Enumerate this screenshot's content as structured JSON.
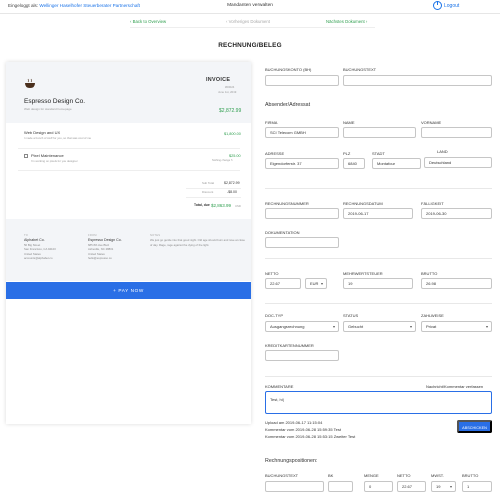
{
  "header": {
    "logged_in_prefix": "Eingeloggt als:",
    "organization": "Wellinger Haselhofer Steuerberater Partnerschaft",
    "title": "Mandanten verwalten",
    "logout": "Logout"
  },
  "nav": {
    "back": "‹ Back to Overview",
    "previous": "‹ Vorheriges Dokument",
    "next": "Nächstes Dokument ›"
  },
  "page_title": "RECHNUNG/BELEG",
  "invoice": {
    "word": "INVOICE",
    "meta1": "#00024",
    "meta2": "June 1st, 2019",
    "company": "Espresso Design Co.",
    "tagline": "Web design for standard homepage",
    "total": "$2,872.99",
    "items": [
      {
        "title": "Web Design and UX",
        "desc": "I made a bunch of stuff for you, so that was cool of me",
        "price": "$1,800.00"
      },
      {
        "title": "Pixel Maintenance",
        "desc": "I'm working on pixels for you designer",
        "price": "$25.00",
        "note": "Nothing change ↻"
      }
    ],
    "summary": [
      {
        "label": "Sub Total",
        "value": "$2,872.99"
      },
      {
        "label": "Discount",
        "value": "-$8.00"
      },
      {
        "label": "Total, due",
        "value": "$2,863.99",
        "currency": "USD"
      }
    ],
    "footer": {
      "to": {
        "head": "TO",
        "name": "Alphabet Co.",
        "lines": [
          "50 Big Street",
          "San Francisco, CA 94103",
          "United States",
          "accounts@alphabet.co"
        ]
      },
      "from": {
        "head": "FROM",
        "name": "Espresso Design Co.",
        "lines": [
          "685 8th Ave Blvd",
          "Asheville, NC 28801",
          "United States",
          "hello@espresso.co"
        ]
      },
      "notes": {
        "head": "NOTES",
        "text": "We just go gentle into that good night. Old age should burn and rave at close of day. Rage, rage against the dying of the light."
      }
    },
    "pay_button": "+ PAY NOW"
  },
  "form": {
    "buchungskonto_label": "BUCHUNGSKONTO (BH)",
    "buchungstext_label": "BUCHUNGSTEXT",
    "absender_head": "Absender/Adressat",
    "firma_label": "FIRMA",
    "firma_value": "SCI Telecom GMBH",
    "name_label": "NAME",
    "vorname_label": "VORNAME",
    "adresse_label": "ADRESSE",
    "adresse_value": "Eigendorferstr. 37",
    "plz_label": "PLZ",
    "plz_value": "6840",
    "stadt_label": "STADT",
    "stadt_value": "Montafour",
    "land_label": "LAND",
    "land_value": "Deutschland",
    "rechnungsnummer_label": "RECHNUNGSNUMMER",
    "rechnungsdatum_label": "RECHNUNGSDATUM",
    "rechnungsdatum_value": "2019-06-17",
    "faelligkeit_label": "FÄLLIGKEIT",
    "faelligkeit_value": "2019-06-30",
    "dokumentation_label": "DOKUMENTATION",
    "netto_label": "NETTO",
    "netto_value": "22.67",
    "currency_value": "EUR",
    "mwst_label": "MEHRWERTSTEUER",
    "mwst_value": "19",
    "brutto_label": "BRUTTO",
    "brutto_value": "26.98",
    "doctyp_label": "DOC-TYP",
    "doctyp_value": "Ausgangsrechnung",
    "status_label": "STATUS",
    "status_value": "Gebucht",
    "zahlweise_label": "ZAHLWEISE",
    "zahlweise_value": "Privat",
    "kreditkarte_label": "KREDITKARTENNUMMER",
    "kommentare_label": "KOMMENTARE",
    "kommentar_link": "Nachricht/Kommentar verfassen",
    "kommentar_value": "Test, hi|",
    "absenden": "ABSCHICKEN",
    "log": [
      "Upload am 2019-06-17 11:15:04",
      "Kommentar vom 2019-06-28 15:59:35 Test",
      "Kommentar vom 2019-06-28 15:53:15 Zweiter Test"
    ],
    "positions_head": "Rechnungspositionen:",
    "positions_cols": [
      "BUCHUNGSTEXT",
      "BK",
      "MENGE",
      "NETTO",
      "MWST.",
      "BRUTTO"
    ],
    "positions_row": [
      "",
      "",
      "0",
      "22.67",
      "19",
      "1"
    ]
  }
}
